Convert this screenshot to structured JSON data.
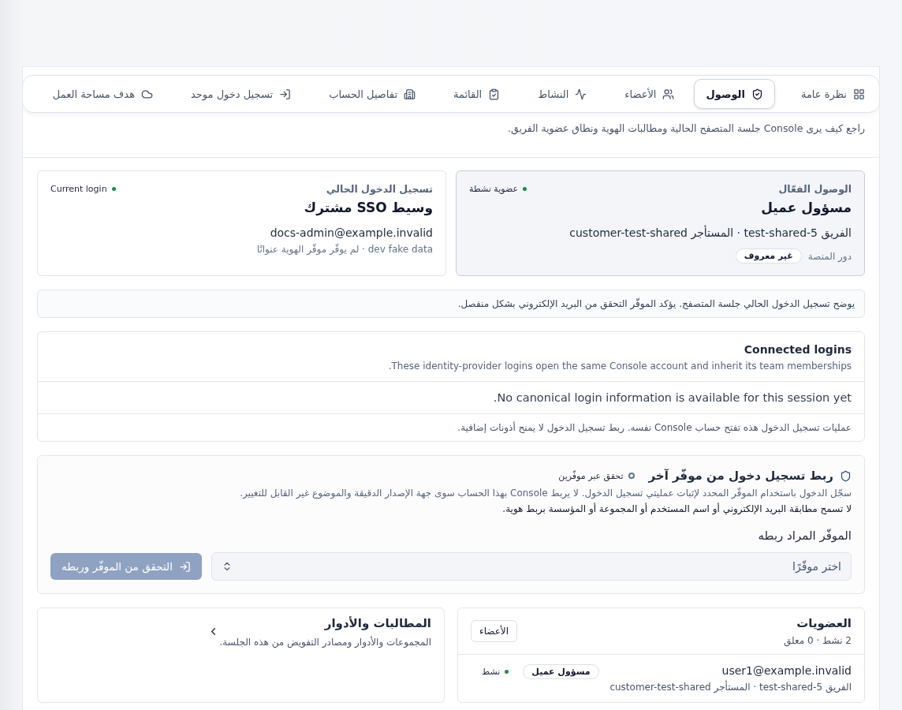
{
  "tabs": [
    {
      "label": "نظرة عامة",
      "selected": false
    },
    {
      "label": "الوصول",
      "selected": true
    },
    {
      "label": "الأعضاء",
      "selected": false
    },
    {
      "label": "النشاط",
      "selected": false
    },
    {
      "label": "القائمة",
      "selected": false
    },
    {
      "label": "تفاصيل الحساب",
      "selected": false
    },
    {
      "label": "تسجيل دخول موحد",
      "selected": false
    },
    {
      "label": "هدف مساحة العمل",
      "selected": false
    }
  ],
  "intro": "راجع كيف يرى Console جلسة المتصفح الحالية ومطالبات الهوية ونطاق عضوية الفريق.",
  "access_card": {
    "eyebrow": "الوصول الفعّال",
    "status": {
      "label": "عضوية نشطة",
      "color": "#1f8a4c"
    },
    "title": "مسؤول عميل",
    "detail": "الفريق test-shared-5 · المستأجر customer-test-shared",
    "role_label": "دور المنصة",
    "role_value": "غير معروف"
  },
  "login_card": {
    "eyebrow": "تسجيل الدخول الحالي",
    "status": {
      "label": "Current login",
      "color": "#1f8a4c"
    },
    "title": "وسيط SSO مشترك",
    "email": "docs-admin@example.invalid",
    "note": "dev fake data · لم يوفّر موفّر الهوية عنوانًا"
  },
  "notice": "يوضح تسجيل الدخول الحالي جلسة المتصفح. يؤكد الموفّر التحقق من البريد الإلكتروني بشكل منفصل.",
  "connected": {
    "title": "Connected logins",
    "subtitle": "These identity-provider logins open the same Console account and inherit its team memberships.",
    "empty": "No canonical login information is available for this session yet.",
    "footer": "عمليات تسجيل الدخول هذه تفتح حساب Console نفسه. ربط تسجيل الدخول لا يمنح أذونات إضافية."
  },
  "link": {
    "title": "ربط تسجيل دخول من موفّر آخر",
    "status": {
      "label": "تحقق عبر موفّرين",
      "color": "#64748b"
    },
    "text1": "سجّل الدخول باستخدام الموفّر المحدد لإثبات عمليتي تسجيل الدخول. لا يربط Console بهذا الحساب سوى جهة الإصدار الدقيقة والموضوع غير القابل للتغيير.",
    "text2": "لا تسمح مطابقة البريد الإلكتروني أو اسم المستخدم أو المجموعة أو المؤسسة بربط هوية.",
    "field_label": "الموفّر المراد ربطه",
    "placeholder": "اختر موفّرًا",
    "button": {
      "label": "التحقق من الموفّر وربطه",
      "disabled": true
    }
  },
  "memberships": {
    "title": "العضويات",
    "summary": "2 نشط · 0 معلق",
    "button": "الأعضاء",
    "rows": [
      {
        "email": "user1@example.invalid",
        "detail": "الفريق test-shared-5 · المستأجر customer-test-shared",
        "role": "مسؤول عميل",
        "status": {
          "label": "نشط",
          "color": "#1f8a4c"
        }
      }
    ]
  },
  "claims": {
    "title": "المطالبات والأدوار",
    "subtitle": "المجموعات والأدوار ومصادر التفويض من هذه الجلسة.",
    "expanded": false
  }
}
